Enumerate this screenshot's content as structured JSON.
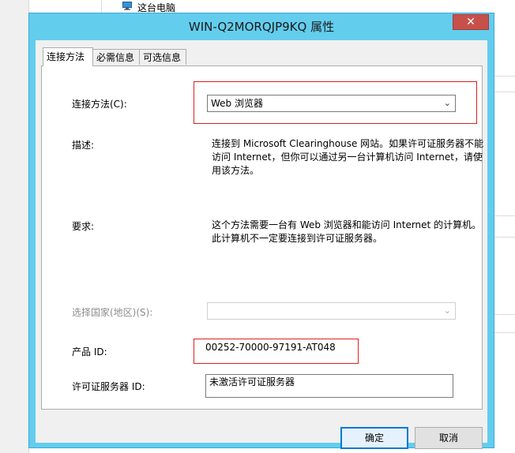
{
  "background": {
    "explorer_item": "这台电脑"
  },
  "dialog": {
    "title": "WIN-Q2MORQJP9KQ 属性",
    "close_symbol": "✕"
  },
  "tabs": [
    {
      "label": "连接方法",
      "active": true
    },
    {
      "label": "必需信息",
      "active": false
    },
    {
      "label": "可选信息",
      "active": false
    }
  ],
  "form": {
    "connection_label": "连接方法(C):",
    "connection_value": "Web 浏览器",
    "description_label": "描述:",
    "description_text": "连接到 Microsoft Clearinghouse 网站。如果许可证服务器不能访问 Internet，但你可以通过另一台计算机访问 Internet，请使用该方法。",
    "requirements_label": "要求:",
    "requirements_text": "这个方法需要一台有 Web 浏览器和能访问 Internet 的计算机。此计算机不一定要连接到许可证服务器。",
    "country_label": "选择国家(地区)(S):",
    "country_value": "",
    "product_id_label": "产品 ID:",
    "product_id_value": "00252-70000-97191-AT048",
    "license_server_label": "许可证服务器 ID:",
    "license_server_value": "未激活许可证服务器"
  },
  "buttons": {
    "ok": "确定",
    "cancel": "取消"
  },
  "colors": {
    "title_bar": "#63cdee",
    "close_button": "#c7504b",
    "highlight_box": "#e02020",
    "default_button_border": "#0078d7"
  }
}
